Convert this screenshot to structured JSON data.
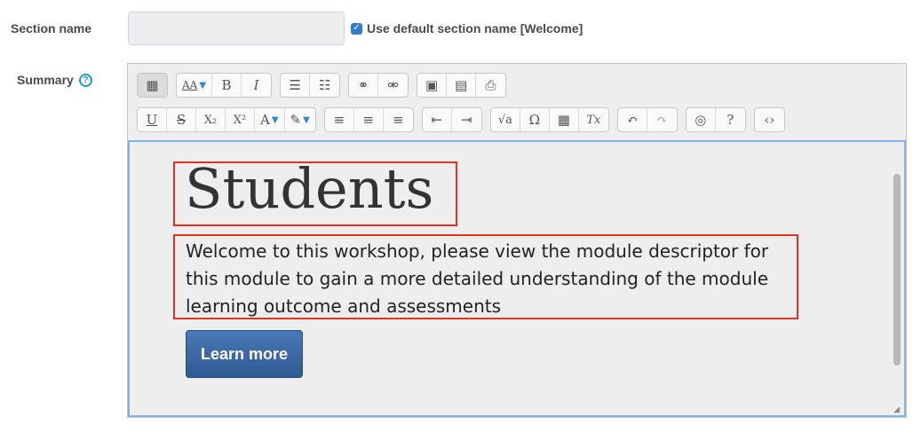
{
  "form": {
    "section_name_label": "Section name",
    "section_name_value": "",
    "use_default_label": "Use default section name [Welcome]",
    "summary_label": "Summary",
    "help_glyph": "?"
  },
  "toolbar": {
    "row1": [
      {
        "name": "toolbar-toggle-button",
        "glyph": "▦",
        "active": true
      },
      {
        "name": "font-style-button",
        "glyph": "AA",
        "caret": true
      },
      {
        "name": "bold-button",
        "glyph": "B"
      },
      {
        "name": "italic-button",
        "glyph": "I"
      },
      {
        "name": "bullet-list-button",
        "glyph": "☰"
      },
      {
        "name": "numbered-list-button",
        "glyph": "☷"
      },
      {
        "name": "link-button",
        "glyph": "⚭"
      },
      {
        "name": "unlink-button",
        "glyph": "⚮"
      },
      {
        "name": "image-button",
        "glyph": "▣"
      },
      {
        "name": "media-button",
        "glyph": "▤"
      },
      {
        "name": "file-button",
        "glyph": "⎙"
      }
    ],
    "row2": [
      {
        "name": "underline-button",
        "glyph": "U"
      },
      {
        "name": "strikethrough-button",
        "glyph": "S"
      },
      {
        "name": "subscript-button",
        "glyph": "X₂"
      },
      {
        "name": "superscript-button",
        "glyph": "X²"
      },
      {
        "name": "font-color-button",
        "glyph": "A",
        "caret": true
      },
      {
        "name": "background-color-button",
        "glyph": "✎",
        "caret": true
      },
      {
        "name": "align-left-button",
        "glyph": "≡"
      },
      {
        "name": "align-center-button",
        "glyph": "≡"
      },
      {
        "name": "align-right-button",
        "glyph": "≡"
      },
      {
        "name": "outdent-button",
        "glyph": "⇤"
      },
      {
        "name": "indent-button",
        "glyph": "⇥"
      },
      {
        "name": "equation-button",
        "glyph": "√a"
      },
      {
        "name": "special-char-button",
        "glyph": "Ω"
      },
      {
        "name": "table-button",
        "glyph": "▦"
      },
      {
        "name": "clear-format-button",
        "glyph": "Tx"
      },
      {
        "name": "undo-button",
        "glyph": "↶"
      },
      {
        "name": "redo-button",
        "glyph": "↷",
        "dim": true
      },
      {
        "name": "accessibility-checker-button",
        "glyph": "◎"
      },
      {
        "name": "screenreader-helper-button",
        "glyph": "?"
      },
      {
        "name": "html-source-button",
        "glyph": "‹›"
      }
    ]
  },
  "content": {
    "heading": "Students",
    "paragraph": "Welcome to this workshop, please view the module descriptor for this module to gain a more detailed understanding of the module learning outcome and assessments",
    "button_label": "Learn more"
  },
  "colors": {
    "highlight_box": "#e4321e",
    "editor_focus": "#7fb1ec",
    "button_bg": "#3d6aa8"
  }
}
